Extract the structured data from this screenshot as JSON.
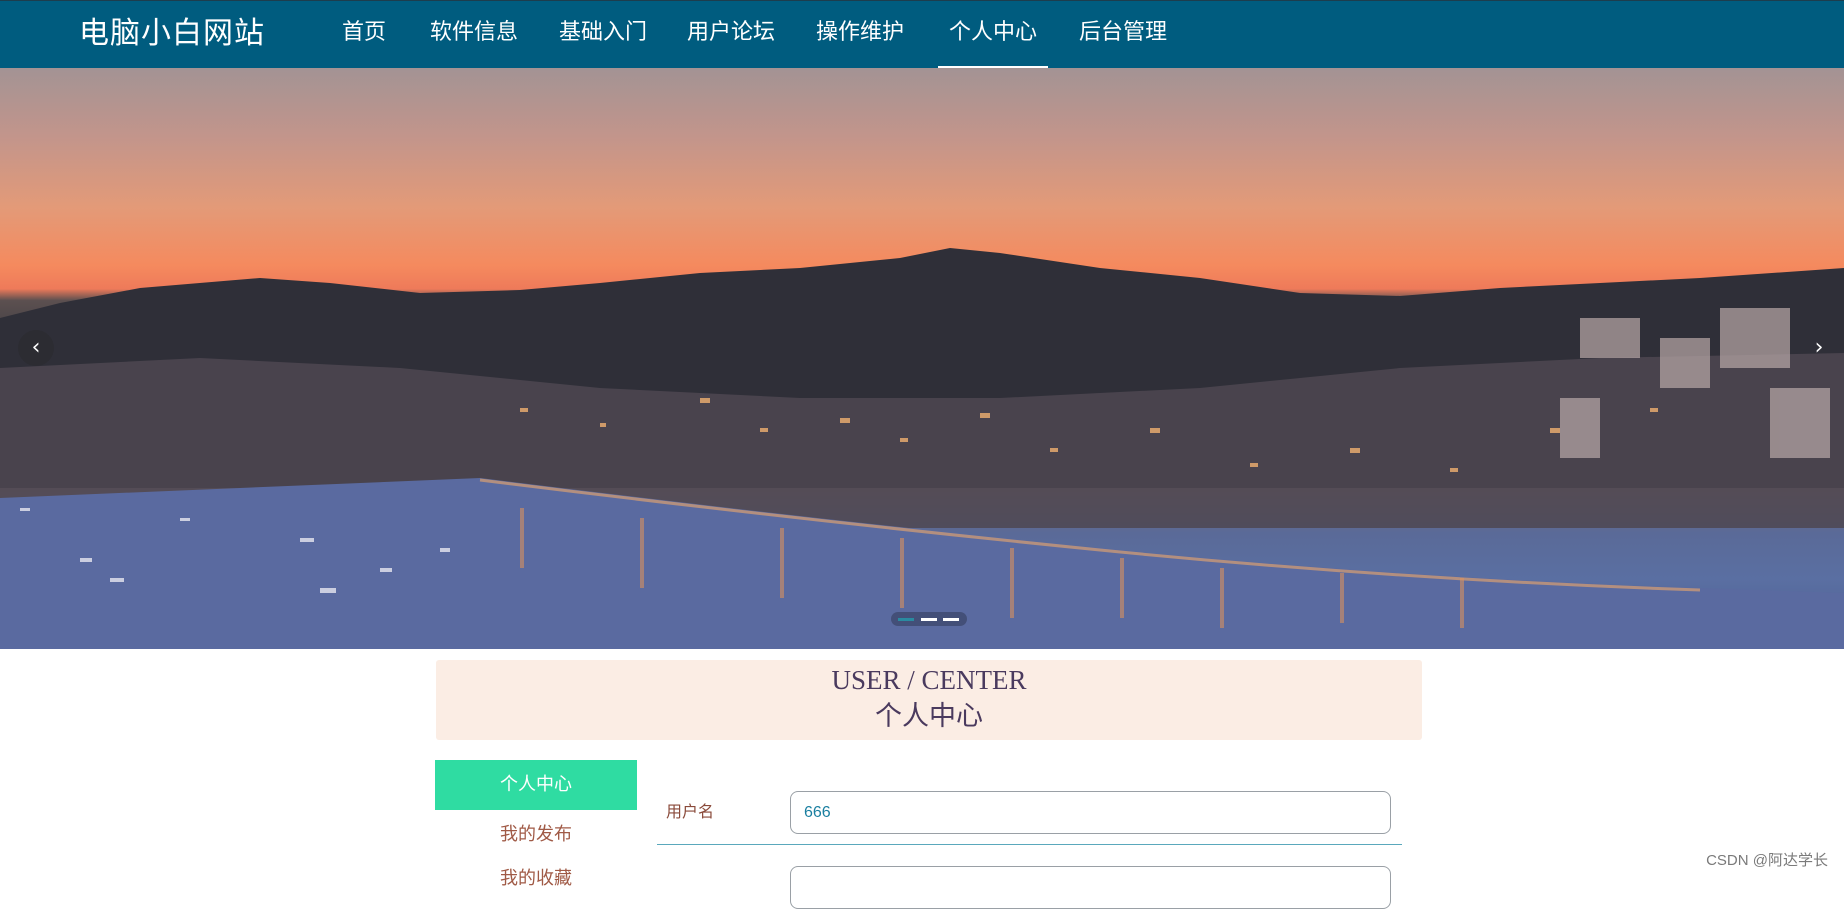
{
  "brand": "电脑小白网站",
  "nav": {
    "items": [
      {
        "label": "首页"
      },
      {
        "label": "软件信息"
      },
      {
        "label": "基础入门"
      },
      {
        "label": "用户论坛"
      },
      {
        "label": "操作维护"
      },
      {
        "label": "个人中心",
        "active": true
      },
      {
        "label": "后台管理"
      }
    ]
  },
  "banner": {
    "prev_icon": "‹",
    "next_icon": "›",
    "indicators": 3,
    "active_indicator": 0
  },
  "center": {
    "title_en": "USER / CENTER",
    "title_cn": "个人中心"
  },
  "sidebar": {
    "items": [
      {
        "label": "个人中心",
        "active": true
      },
      {
        "label": "我的发布"
      },
      {
        "label": "我的收藏"
      }
    ]
  },
  "form": {
    "username_label": "用户名",
    "username_value": "666"
  },
  "watermark": "CSDN @阿达学长",
  "colors": {
    "header": "#005c7f",
    "active_menu": "#2fdca2",
    "section_bg": "#fbede4"
  }
}
